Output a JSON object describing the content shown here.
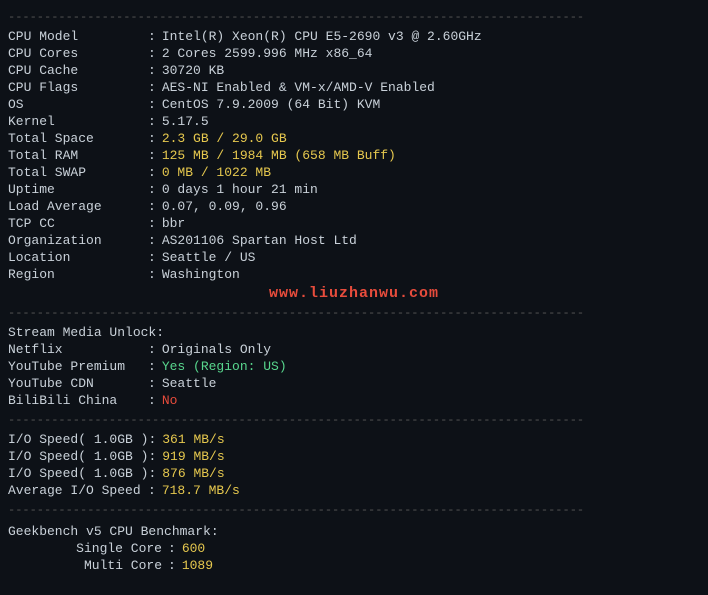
{
  "divider": "--------------------------------------------------------------------------------",
  "system_info": {
    "rows": [
      {
        "label": "CPU Model",
        "colon": ":",
        "value": "Intel(R) Xeon(R) CPU E5-2690 v3 @ 2.60GHz",
        "color": "default"
      },
      {
        "label": "CPU Cores",
        "colon": ":",
        "value": "2 Cores 2599.996 MHz x86_64",
        "color": "default"
      },
      {
        "label": "CPU Cache",
        "colon": ":",
        "value": "30720 KB",
        "color": "default"
      },
      {
        "label": "CPU Flags",
        "colon": ":",
        "value": "AES-NI Enabled & VM-x/AMD-V Enabled",
        "color": "default"
      },
      {
        "label": "OS",
        "colon": ":",
        "value": "CentOS 7.9.2009 (64 Bit) KVM",
        "color": "default"
      },
      {
        "label": "Kernel",
        "colon": ":",
        "value": "5.17.5",
        "color": "default"
      },
      {
        "label": "Total Space",
        "colon": ":",
        "value": "2.3 GB / 29.0 GB",
        "color": "yellow"
      },
      {
        "label": "Total RAM",
        "colon": ":",
        "value": "125 MB / 1984 MB (658 MB Buff)",
        "color": "yellow"
      },
      {
        "label": "Total SWAP",
        "colon": ":",
        "value": "0 MB / 1022 MB",
        "color": "yellow"
      },
      {
        "label": "Uptime",
        "colon": ":",
        "value": "0 days 1 hour 21 min",
        "color": "default"
      },
      {
        "label": "Load Average",
        "colon": ":",
        "value": "0.07, 0.09, 0.96",
        "color": "default"
      },
      {
        "label": "TCP CC",
        "colon": ":",
        "value": "bbr",
        "color": "default"
      },
      {
        "label": "Organization",
        "colon": ":",
        "value": "AS201106 Spartan Host Ltd",
        "color": "default"
      },
      {
        "label": "Location",
        "colon": ":",
        "value": "Seattle / US",
        "color": "default"
      },
      {
        "label": "Region",
        "colon": ":",
        "value": "Washington",
        "color": "default"
      }
    ]
  },
  "watermark": "www.liuzhanwu.com",
  "stream_media": {
    "title": "Stream Media Unlock :",
    "rows": [
      {
        "label": "Netflix",
        "colon": ":",
        "value": "Originals Only",
        "color": "default"
      },
      {
        "label": "YouTube Premium",
        "colon": ":",
        "value": "Yes (Region: US)",
        "color": "green"
      },
      {
        "label": "YouTube CDN",
        "colon": ":",
        "value": "Seattle",
        "color": "default"
      },
      {
        "label": "BiliBili China",
        "colon": ":",
        "value": "No",
        "color": "red"
      }
    ]
  },
  "io_speed": {
    "rows": [
      {
        "label": "I/O Speed( 1.0GB )",
        "colon": ":",
        "value": "361 MB/s",
        "color": "yellow"
      },
      {
        "label": "I/O Speed( 1.0GB )",
        "colon": ":",
        "value": "919 MB/s",
        "color": "yellow"
      },
      {
        "label": "I/O Speed( 1.0GB )",
        "colon": ":",
        "value": "876 MB/s",
        "color": "yellow"
      },
      {
        "label": "Average I/O Speed",
        "colon": ":",
        "value": "718.7 MB/s",
        "color": "yellow"
      }
    ]
  },
  "geekbench": {
    "title": "Geekbench v5 CPU Benchmark:",
    "rows": [
      {
        "label": "Single Core",
        "colon": ":",
        "value": "600",
        "color": "yellow"
      },
      {
        "label": "Multi Core",
        "colon": ":",
        "value": "1089",
        "color": "yellow"
      }
    ]
  }
}
